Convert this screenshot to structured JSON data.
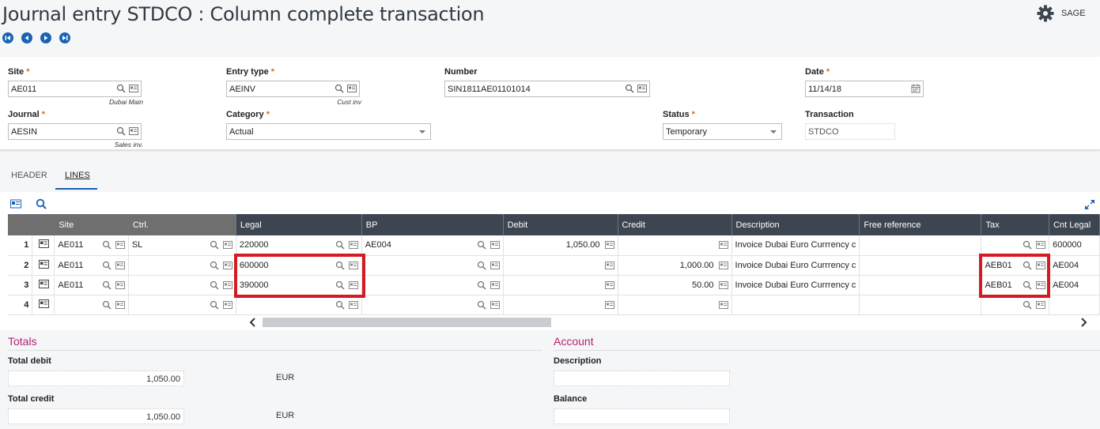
{
  "page": {
    "title": "Journal entry STDCO : Column complete transaction",
    "app_label": "SAGE"
  },
  "nav": [
    "first-record",
    "previous-record",
    "next-record",
    "last-record"
  ],
  "form": {
    "site": {
      "label": "Site",
      "value": "AE011",
      "sub": "Dubai Main"
    },
    "entry_type": {
      "label": "Entry type",
      "value": "AEINV",
      "sub": "Cust inv"
    },
    "number": {
      "label": "Number",
      "value": "SIN1811AE01101014"
    },
    "date": {
      "label": "Date",
      "value": "11/14/18"
    },
    "journal": {
      "label": "Journal",
      "value": "AESIN",
      "sub": "Sales inv."
    },
    "category": {
      "label": "Category",
      "value": "Actual"
    },
    "status": {
      "label": "Status",
      "value": "Temporary"
    },
    "transaction": {
      "label": "Transaction",
      "value": "STDCO"
    }
  },
  "tabs": {
    "header": "HEADER",
    "lines": "LINES"
  },
  "grid": {
    "columns": [
      "Site",
      "Ctrl.",
      "Legal",
      "BP",
      "Debit",
      "Credit",
      "Description",
      "Free reference",
      "Tax",
      "Cnt Legal"
    ],
    "rows": [
      {
        "n": "1",
        "site": "AE011",
        "ctrl": "SL",
        "legal": "220000",
        "bp": "AE004",
        "debit": "1,050.00",
        "credit": "",
        "description": "Invoice Dubai Euro Currrency c",
        "free_ref": "",
        "tax": "",
        "cnt_legal": "600000"
      },
      {
        "n": "2",
        "site": "AE011",
        "ctrl": "",
        "legal": "600000",
        "bp": "",
        "debit": "",
        "credit": "1,000.00",
        "description": "Invoice Dubai Euro Currrency c",
        "free_ref": "",
        "tax": "AEB01",
        "cnt_legal": "AE004"
      },
      {
        "n": "3",
        "site": "AE011",
        "ctrl": "",
        "legal": "390000",
        "bp": "",
        "debit": "",
        "credit": "50.00",
        "description": "Invoice Dubai Euro Currrency c",
        "free_ref": "",
        "tax": "AEB01",
        "cnt_legal": "AE004"
      },
      {
        "n": "4",
        "site": "",
        "ctrl": "",
        "legal": "",
        "bp": "",
        "debit": "",
        "credit": "",
        "description": "",
        "free_ref": "",
        "tax": "",
        "cnt_legal": ""
      }
    ]
  },
  "totals": {
    "title": "Totals",
    "total_debit": {
      "label": "Total debit",
      "value": "1,050.00",
      "currency": "EUR"
    },
    "total_credit": {
      "label": "Total credit",
      "value": "1,050.00",
      "currency": "EUR"
    }
  },
  "account": {
    "title": "Account",
    "description": {
      "label": "Description",
      "value": ""
    },
    "balance": {
      "label": "Balance",
      "value": ""
    }
  },
  "colors": {
    "accent": "#1a63b3",
    "required": "#e06c1f",
    "section_title": "#b51f72",
    "highlight": "#d41b22",
    "grid_header": "#3d4550"
  }
}
